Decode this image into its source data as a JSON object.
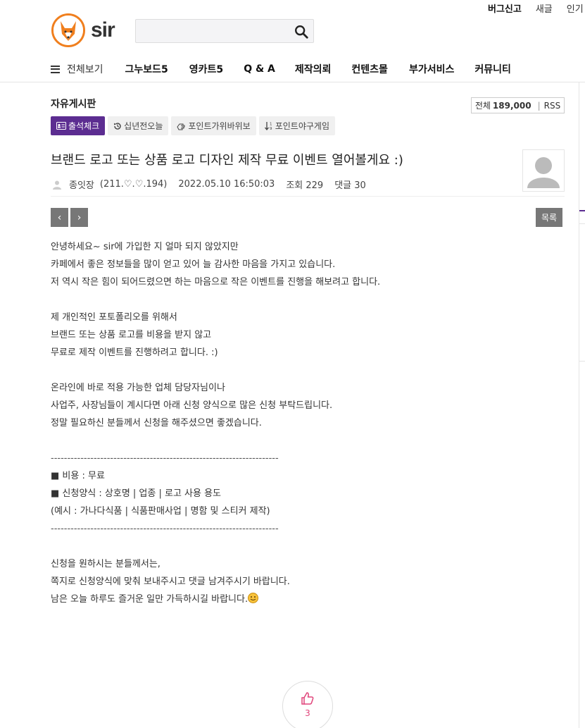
{
  "header": {
    "links": [
      "버그신고",
      "새글",
      "인기"
    ],
    "logo_text": "sir",
    "search": {
      "placeholder": ""
    }
  },
  "gnb": {
    "all_label": "전체보기",
    "items": [
      "그누보드5",
      "영카트5",
      "Q & A",
      "제작의뢰",
      "컨텐츠몰",
      "부가서비스",
      "커뮤니티"
    ]
  },
  "board": {
    "title": "자유게시판",
    "count_label": "전체",
    "count_value": "189,000",
    "rss_label": "RSS",
    "tags": [
      {
        "label": "출석체크",
        "icon": "id-card-icon"
      },
      {
        "label": "십년전오늘",
        "icon": "history-icon"
      },
      {
        "label": "포인트가위바위보",
        "icon": "hand-icon"
      },
      {
        "label": "포인트야구게임",
        "icon": "sort-numeric-icon"
      }
    ]
  },
  "post": {
    "title": "브랜드 로고 또는 상품 로고 디자인 제작 무료 이벤트 열어볼게요 :)",
    "author": "종잇장",
    "ip": "(211.♡.♡.194)",
    "datetime": "2022.05.10 16:50:03",
    "views": "조회 229",
    "comments": "댓글 30",
    "prev_label": "‹",
    "next_label": "›",
    "list_label": "목록",
    "body": [
      "안녕하세요~ sir에 가입한 지 얼마 되지 않았지만",
      "카페에서 좋은 정보들을 많이 얻고 있어 늘 감사한 마음을 가지고 있습니다.",
      "저 역시 작은 힘이 되어드렸으면 하는 마음으로 작은 이벤트를 진행을 해보려고 합니다.",
      "",
      "제 개인적인 포토폴리오를 위해서",
      "브랜드 또는 상품 로고를 비용을 받지 않고",
      "무료로 제작 이벤트를 진행하려고 합니다. :)",
      "",
      "온라인에 바로 적용 가능한 업체 담당자님이나",
      "사업주, 사장님들이 계시다면 아래 신청 양식으로 많은 신청 부탁드립니다.",
      "정말 필요하신 분들께서 신청을 해주셨으면 좋겠습니다.",
      "",
      "---------------------------------------------------------------------",
      "■ 비용 : 무료",
      "■ 신청양식 : 상호명 | 업종 | 로고 사용 용도",
      "(예시 : 가나다식품 | 식품판매사업 | 명함 및 스티커 제작)",
      "---------------------------------------------------------------------",
      "",
      "신청을 원하시는 분들께서는,",
      "쪽지로 신청양식에 맞춰 보내주시고 댓글 남겨주시기 바랍니다.",
      "남은 오늘 하루도 즐거운 일만 가득하시길 바랍니다."
    ],
    "like_count": "3"
  }
}
